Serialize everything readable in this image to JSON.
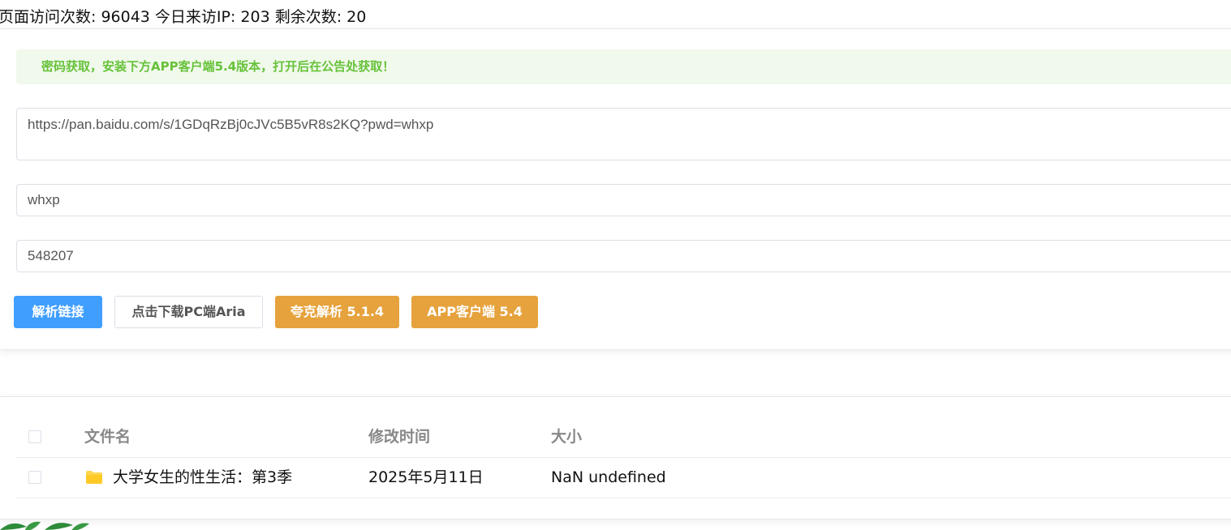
{
  "stats": {
    "text": "页面访问次数: 96043 今日来访IP: 203 剩余次数: 20"
  },
  "notice": {
    "text": "密码获取，安装下方APP客户端5.4版本，打开后在公告处获取！"
  },
  "form": {
    "url_value": "https://pan.baidu.com/s/1GDqRzBj0cJVc5B5vR8s2KQ?pwd=whxp",
    "password_value": "whxp",
    "code_value": "548207"
  },
  "buttons": {
    "parse": "解析链接",
    "aria": "点击下载PC端Aria",
    "quark": "夸克解析 5.1.4",
    "app": "APP客户端 5.4"
  },
  "table": {
    "headers": {
      "name": "文件名",
      "time": "修改时间",
      "size": "大小"
    },
    "rows": [
      {
        "name": "大学女生的性生活：第3季",
        "time": "2025年5月11日",
        "size": "NaN undefined",
        "icon": "folder-icon"
      }
    ]
  },
  "colors": {
    "primary": "#409eff",
    "warning": "#e6a23c",
    "success_text": "#67c23a",
    "success_bg": "#f0f9eb",
    "folder": "#ffd54f"
  }
}
